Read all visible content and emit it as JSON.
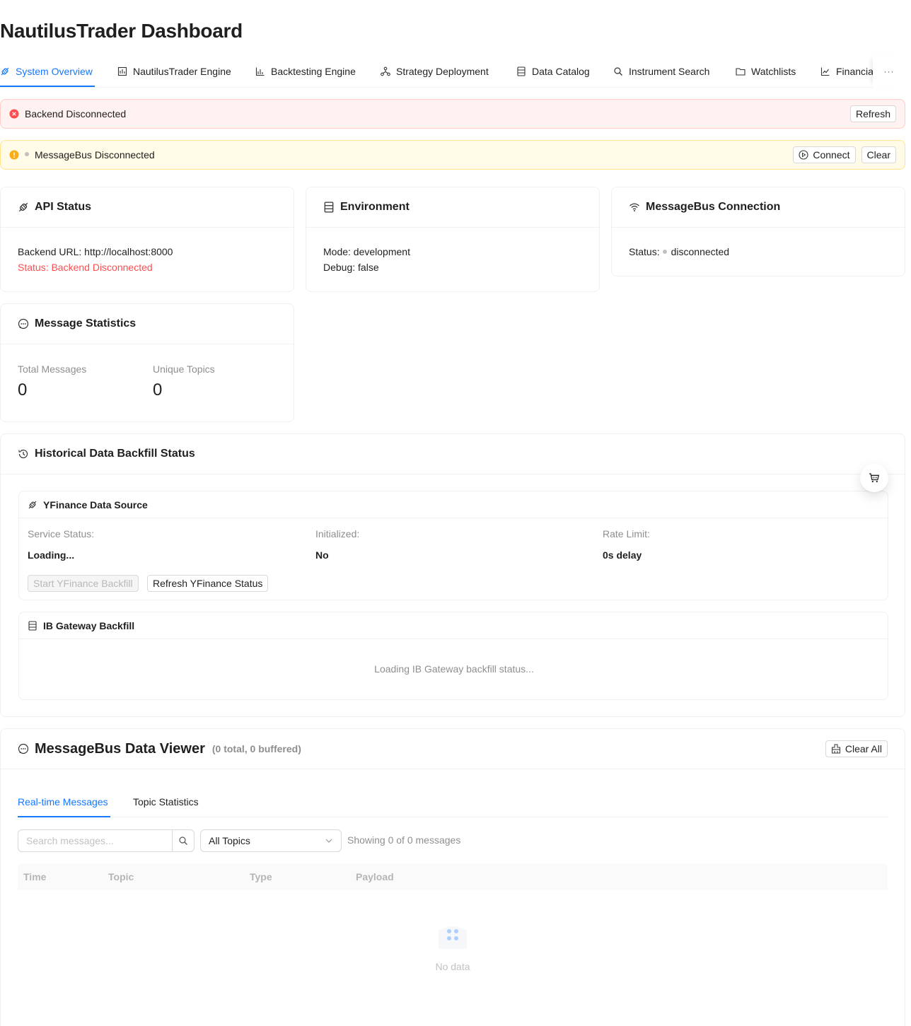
{
  "app": {
    "title": "NautilusTrader Dashboard"
  },
  "tabs": [
    {
      "label": "System Overview",
      "icon": "api-icon",
      "active": true
    },
    {
      "label": "NautilusTrader Engine",
      "icon": "fund-icon"
    },
    {
      "label": "Backtesting Engine",
      "icon": "bar-chart-icon"
    },
    {
      "label": "Strategy Deployment",
      "icon": "deployment-icon"
    },
    {
      "label": "Data Catalog",
      "icon": "database-icon"
    },
    {
      "label": "Instrument Search",
      "icon": "search-icon"
    },
    {
      "label": "Watchlists",
      "icon": "folder-icon"
    },
    {
      "label": "Financia",
      "icon": "line-chart-icon"
    }
  ],
  "tabs_more": "···",
  "alerts": {
    "backend": {
      "message": "Backend Disconnected",
      "button": "Refresh",
      "color": "#ff4d4f"
    },
    "messagebus": {
      "message": "MessageBus Disconnected",
      "connect": "Connect",
      "clear": "Clear",
      "color": "#faad14"
    }
  },
  "api_status": {
    "title": "API Status",
    "backend_url": "Backend URL: http://localhost:8000",
    "status": "Status: Backend Disconnected"
  },
  "environment": {
    "title": "Environment",
    "mode": "Mode: development",
    "debug": "Debug: false"
  },
  "messagebus_connection": {
    "title": "MessageBus Connection",
    "status_label": "Status:",
    "status_value": "disconnected"
  },
  "message_statistics": {
    "title": "Message Statistics",
    "total_label": "Total Messages",
    "total_value": "0",
    "topics_label": "Unique Topics",
    "topics_value": "0"
  },
  "backfill": {
    "title": "Historical Data Backfill Status",
    "yfinance": {
      "title": "YFinance Data Source",
      "service_status_label": "Service Status:",
      "service_status_value": "Loading...",
      "initialized_label": "Initialized:",
      "initialized_value": "No",
      "rate_limit_label": "Rate Limit:",
      "rate_limit_value": "0s delay",
      "start_button": "Start YFinance Backfill",
      "refresh_button": "Refresh YFinance Status"
    },
    "ib_gateway": {
      "title": "IB Gateway Backfill",
      "loading_text": "Loading IB Gateway backfill status..."
    }
  },
  "viewer": {
    "title": "MessageBus Data Viewer",
    "counts": "(0 total, 0 buffered)",
    "clear_all": "Clear All",
    "tabs": [
      {
        "label": "Real-time Messages",
        "active": true
      },
      {
        "label": "Topic Statistics"
      }
    ],
    "search_placeholder": "Search messages...",
    "topic_select": "All Topics",
    "showing": "Showing 0 of 0 messages",
    "columns": [
      "Time",
      "Topic",
      "Type",
      "Payload"
    ],
    "empty_text": "No data"
  },
  "colors": {
    "primary": "#1677ff",
    "error": "#ff4d4f",
    "warning": "#faad14"
  }
}
